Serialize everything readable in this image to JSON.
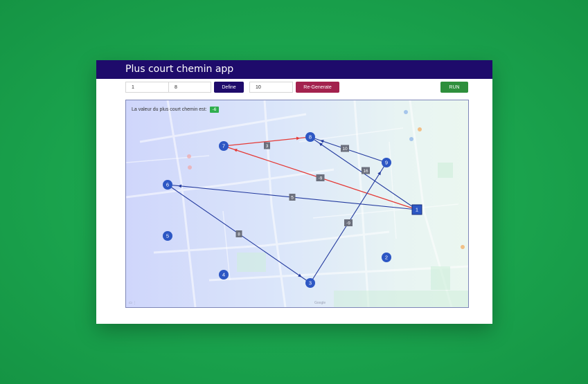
{
  "app": {
    "title": "Plus court chemin app"
  },
  "toolbar": {
    "source_value": "1",
    "target_value": "8",
    "define_label": "Define",
    "count_value": "10",
    "regenerate_label": "Re-Generate",
    "run_label": "RUN"
  },
  "result": {
    "label": "La valeur du plus court chemin est:",
    "value": "-6"
  },
  "map": {
    "watermark": "Google"
  },
  "colors": {
    "header": "#1e0b6b",
    "define_button": "#1e0b6b",
    "regenerate_button": "#a3224e",
    "run_button": "#2e8f3c",
    "node_fill": "#2d57c4",
    "edge_default": "#233a9e",
    "edge_shortest_path": "#e53935",
    "weight_label": "#6b6f7c",
    "result_badge": "#2fae4e"
  },
  "graph": {
    "nodes": [
      {
        "id": "1",
        "selected": true
      },
      {
        "id": "2"
      },
      {
        "id": "3"
      },
      {
        "id": "4"
      },
      {
        "id": "5"
      },
      {
        "id": "6"
      },
      {
        "id": "7"
      },
      {
        "id": "8"
      },
      {
        "id": "9"
      }
    ],
    "edges": [
      {
        "from": "7",
        "to": "8",
        "weight": "3",
        "on_path": true
      },
      {
        "from": "1",
        "to": "7",
        "weight": "-9",
        "on_path": true
      },
      {
        "from": "9",
        "to": "8",
        "weight": "10",
        "on_path": false
      },
      {
        "from": "1",
        "to": "8",
        "weight": "16",
        "on_path": false
      },
      {
        "from": "1",
        "to": "6",
        "weight": "5",
        "on_path": false
      },
      {
        "from": "6",
        "to": "3",
        "weight": "8",
        "on_path": false
      },
      {
        "from": "3",
        "to": "9",
        "weight": "-9",
        "on_path": false
      }
    ]
  }
}
